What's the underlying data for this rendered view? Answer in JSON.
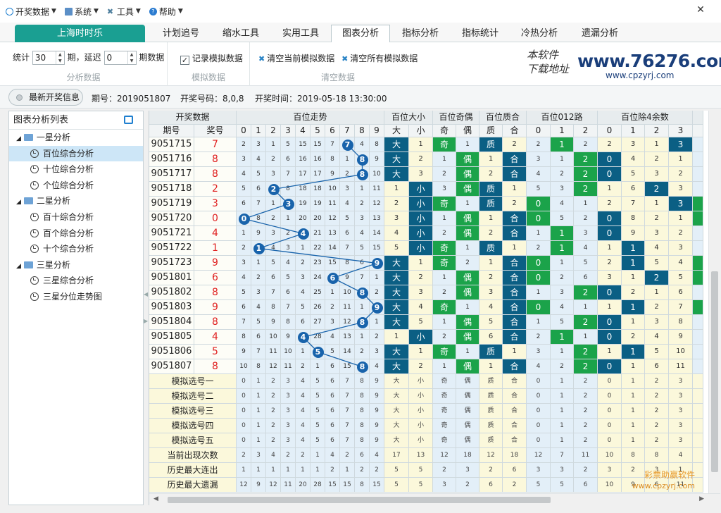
{
  "menu": [
    {
      "label": "开奖数据",
      "icon": "circle-icon"
    },
    {
      "label": "系统",
      "icon": "monitor-icon"
    },
    {
      "label": "工具",
      "icon": "tools-icon"
    },
    {
      "label": "帮助",
      "icon": "help-icon"
    }
  ],
  "window": {
    "close": "✕"
  },
  "tabs": [
    "上海时时乐",
    "计划追号",
    "缩水工具",
    "实用工具",
    "图表分析",
    "指标分析",
    "指标统计",
    "冷热分析",
    "遗漏分析"
  ],
  "active_tab": "图表分析",
  "toolbar": {
    "stat_label": "统计",
    "stat_value": "30",
    "period_label": "期，延迟",
    "delay_value": "0",
    "period_data_label": "期数据",
    "group1_caption": "分析数据",
    "record_label": "记录模拟数据",
    "record_checked": true,
    "group2_caption": "模拟数据",
    "clear_current": "清空当前模拟数据",
    "clear_all": "清空所有模拟数据",
    "group3_caption": "清空数据",
    "logo_hand1": "本软件",
    "logo_hand2": "下载地址",
    "logo_url": "www.76276.com",
    "logo_sub": "www.cpzyrj.com"
  },
  "infobar": {
    "button": "最新开奖信息",
    "period_label": "期号：",
    "period_value": "2019051807",
    "code_label": "开奖号码：",
    "code_value": "8,0,8",
    "time_label": "开奖时间：",
    "time_value": "2019-05-18 13:30:00"
  },
  "tree": {
    "title": "图表分析列表",
    "groups": [
      {
        "label": "一星分析",
        "items": [
          "百位综合分析",
          "十位综合分析",
          "个位综合分析"
        ]
      },
      {
        "label": "二星分析",
        "items": [
          "百十综合分析",
          "百个综合分析",
          "十个综合分析"
        ]
      },
      {
        "label": "三星分析",
        "items": [
          "三星综合分析",
          "三星分位走势图"
        ]
      }
    ],
    "selected": "百位综合分析"
  },
  "grid": {
    "group_headers": [
      "开奖数据",
      "百位走势",
      "百位大小",
      "百位奇偶",
      "百位质合",
      "百位012路",
      "百位除4余数"
    ],
    "sub_headers": [
      "期号",
      "奖号",
      "0",
      "1",
      "2",
      "3",
      "4",
      "5",
      "6",
      "7",
      "8",
      "9",
      "大",
      "小",
      "奇",
      "偶",
      "质",
      "合",
      "0",
      "1",
      "2",
      "0",
      "1",
      "2",
      "3"
    ],
    "rows": [
      {
        "period": "9051715",
        "num": "7",
        "trend": [
          "2",
          "3",
          "1",
          "5",
          "15",
          "15",
          "7",
          "7",
          "4",
          "8"
        ],
        "ds": [
          "大",
          "1"
        ],
        "jo": [
          "奇",
          "1"
        ],
        "zh": [
          "质",
          "2"
        ],
        "r012": [
          "2",
          "1",
          "2"
        ],
        "m4": [
          "2",
          "3",
          "1",
          "3"
        ]
      },
      {
        "period": "9051716",
        "num": "8",
        "trend": [
          "3",
          "4",
          "2",
          "6",
          "16",
          "16",
          "8",
          "1",
          "8",
          "9"
        ],
        "ds": [
          "大",
          "2"
        ],
        "jo": [
          "1",
          "偶"
        ],
        "zh": [
          "1",
          "合"
        ],
        "r012": [
          "3",
          "1",
          "2"
        ],
        "m4": [
          "0",
          "4",
          "2",
          "1"
        ]
      },
      {
        "period": "9051717",
        "num": "8",
        "trend": [
          "4",
          "5",
          "3",
          "7",
          "17",
          "17",
          "9",
          "2",
          "8",
          "10"
        ],
        "ds": [
          "大",
          "3"
        ],
        "jo": [
          "2",
          "偶"
        ],
        "zh": [
          "2",
          "合"
        ],
        "r012": [
          "4",
          "2",
          "2"
        ],
        "m4": [
          "0",
          "5",
          "3",
          "2"
        ]
      },
      {
        "period": "9051718",
        "num": "2",
        "trend": [
          "5",
          "6",
          "2",
          "8",
          "18",
          "18",
          "10",
          "3",
          "1",
          "11"
        ],
        "ds": [
          "1",
          "小"
        ],
        "jo": [
          "3",
          "偶"
        ],
        "zh": [
          "质",
          "1"
        ],
        "r012": [
          "5",
          "3",
          "2"
        ],
        "m4": [
          "1",
          "6",
          "2",
          "3"
        ]
      },
      {
        "period": "9051719",
        "num": "3",
        "trend": [
          "6",
          "7",
          "1",
          "3",
          "19",
          "19",
          "11",
          "4",
          "2",
          "12"
        ],
        "ds": [
          "2",
          "小"
        ],
        "jo": [
          "奇",
          "1"
        ],
        "zh": [
          "质",
          "2"
        ],
        "r012": [
          "0",
          "4",
          "1"
        ],
        "m4": [
          "2",
          "7",
          "1",
          "3"
        ]
      },
      {
        "period": "9051720",
        "num": "0",
        "trend": [
          "0",
          "8",
          "2",
          "1",
          "20",
          "20",
          "12",
          "5",
          "3",
          "13"
        ],
        "ds": [
          "3",
          "小"
        ],
        "jo": [
          "1",
          "偶"
        ],
        "zh": [
          "1",
          "合"
        ],
        "r012": [
          "0",
          "5",
          "2"
        ],
        "m4": [
          "0",
          "8",
          "2",
          "1"
        ]
      },
      {
        "period": "9051721",
        "num": "4",
        "trend": [
          "1",
          "9",
          "3",
          "2",
          "4",
          "21",
          "13",
          "6",
          "4",
          "14"
        ],
        "ds": [
          "4",
          "小"
        ],
        "jo": [
          "2",
          "偶"
        ],
        "zh": [
          "2",
          "合"
        ],
        "r012": [
          "1",
          "1",
          "3"
        ],
        "m4": [
          "0",
          "9",
          "3",
          "2"
        ]
      },
      {
        "period": "9051722",
        "num": "1",
        "trend": [
          "2",
          "1",
          "4",
          "3",
          "1",
          "22",
          "14",
          "7",
          "5",
          "15"
        ],
        "ds": [
          "5",
          "小"
        ],
        "jo": [
          "奇",
          "1"
        ],
        "zh": [
          "质",
          "1"
        ],
        "r012": [
          "2",
          "1",
          "4"
        ],
        "m4": [
          "1",
          "1",
          "4",
          "3"
        ]
      },
      {
        "period": "9051723",
        "num": "9",
        "trend": [
          "3",
          "1",
          "5",
          "4",
          "2",
          "23",
          "15",
          "8",
          "6",
          "9"
        ],
        "ds": [
          "大",
          "1"
        ],
        "jo": [
          "奇",
          "2"
        ],
        "zh": [
          "1",
          "合"
        ],
        "r012": [
          "0",
          "1",
          "5"
        ],
        "m4": [
          "2",
          "1",
          "5",
          "4"
        ]
      },
      {
        "period": "9051801",
        "num": "6",
        "trend": [
          "4",
          "2",
          "6",
          "5",
          "3",
          "24",
          "6",
          "9",
          "7",
          "1"
        ],
        "ds": [
          "大",
          "2"
        ],
        "jo": [
          "1",
          "偶"
        ],
        "zh": [
          "2",
          "合"
        ],
        "r012": [
          "0",
          "2",
          "6"
        ],
        "m4": [
          "3",
          "1",
          "2",
          "5"
        ]
      },
      {
        "period": "9051802",
        "num": "8",
        "trend": [
          "5",
          "3",
          "7",
          "6",
          "4",
          "25",
          "1",
          "10",
          "8",
          "2"
        ],
        "ds": [
          "大",
          "3"
        ],
        "jo": [
          "2",
          "偶"
        ],
        "zh": [
          "3",
          "合"
        ],
        "r012": [
          "1",
          "3",
          "2"
        ],
        "m4": [
          "0",
          "2",
          "1",
          "6"
        ]
      },
      {
        "period": "9051803",
        "num": "9",
        "trend": [
          "6",
          "4",
          "8",
          "7",
          "5",
          "26",
          "2",
          "11",
          "1",
          "9"
        ],
        "ds": [
          "大",
          "4"
        ],
        "jo": [
          "奇",
          "1"
        ],
        "zh": [
          "4",
          "合"
        ],
        "r012": [
          "0",
          "4",
          "1"
        ],
        "m4": [
          "1",
          "1",
          "2",
          "7"
        ]
      },
      {
        "period": "9051804",
        "num": "8",
        "trend": [
          "7",
          "5",
          "9",
          "8",
          "6",
          "27",
          "3",
          "12",
          "8",
          "1"
        ],
        "ds": [
          "大",
          "5"
        ],
        "jo": [
          "1",
          "偶"
        ],
        "zh": [
          "5",
          "合"
        ],
        "r012": [
          "1",
          "5",
          "2"
        ],
        "m4": [
          "0",
          "1",
          "3",
          "8"
        ]
      },
      {
        "period": "9051805",
        "num": "4",
        "trend": [
          "8",
          "6",
          "10",
          "9",
          "4",
          "28",
          "4",
          "13",
          "1",
          "2"
        ],
        "ds": [
          "1",
          "小"
        ],
        "jo": [
          "2",
          "偶"
        ],
        "zh": [
          "6",
          "合"
        ],
        "r012": [
          "2",
          "1",
          "1"
        ],
        "m4": [
          "0",
          "2",
          "4",
          "9"
        ]
      },
      {
        "period": "9051806",
        "num": "5",
        "trend": [
          "9",
          "7",
          "11",
          "10",
          "1",
          "5",
          "5",
          "14",
          "2",
          "3"
        ],
        "ds": [
          "大",
          "1"
        ],
        "jo": [
          "奇",
          "1"
        ],
        "zh": [
          "质",
          "1"
        ],
        "r012": [
          "3",
          "1",
          "2"
        ],
        "m4": [
          "1",
          "1",
          "5",
          "10"
        ]
      },
      {
        "period": "9051807",
        "num": "8",
        "trend": [
          "10",
          "8",
          "12",
          "11",
          "2",
          "1",
          "6",
          "15",
          "8",
          "4"
        ],
        "ds": [
          "大",
          "2"
        ],
        "jo": [
          "1",
          "偶"
        ],
        "zh": [
          "1",
          "合"
        ],
        "r012": [
          "4",
          "2",
          "2"
        ],
        "m4": [
          "0",
          "1",
          "6",
          "11"
        ]
      }
    ],
    "sim_rows": [
      "模拟选号一",
      "模拟选号二",
      "模拟选号三",
      "模拟选号四",
      "模拟选号五"
    ],
    "sim_cells": [
      "0",
      "1",
      "2",
      "3",
      "4",
      "5",
      "6",
      "7",
      "8",
      "9",
      "大",
      "小",
      "奇",
      "偶",
      "质",
      "合",
      "0",
      "1",
      "2",
      "0",
      "1",
      "2",
      "3"
    ],
    "stat_rows": [
      {
        "label": "当前出现次数",
        "cells": [
          "2",
          "3",
          "4",
          "2",
          "2",
          "1",
          "4",
          "2",
          "6",
          "4",
          "17",
          "13",
          "12",
          "18",
          "12",
          "18",
          "12",
          "7",
          "11",
          "10",
          "8",
          "8",
          "4"
        ]
      },
      {
        "label": "历史最大连出",
        "cells": [
          "1",
          "1",
          "1",
          "1",
          "1",
          "1",
          "2",
          "1",
          "2",
          "2",
          "5",
          "5",
          "2",
          "3",
          "2",
          "6",
          "3",
          "3",
          "2",
          "3",
          "2",
          "3",
          "1"
        ]
      },
      {
        "label": "历史最大遗漏",
        "cells": [
          "12",
          "9",
          "12",
          "11",
          "20",
          "28",
          "15",
          "15",
          "8",
          "15",
          "5",
          "5",
          "3",
          "2",
          "6",
          "2",
          "5",
          "5",
          "6",
          "10",
          "9",
          "6",
          "11"
        ]
      }
    ],
    "watermark": "彩票助赢软件",
    "watermark_url": "www.cpzyrj.com"
  }
}
